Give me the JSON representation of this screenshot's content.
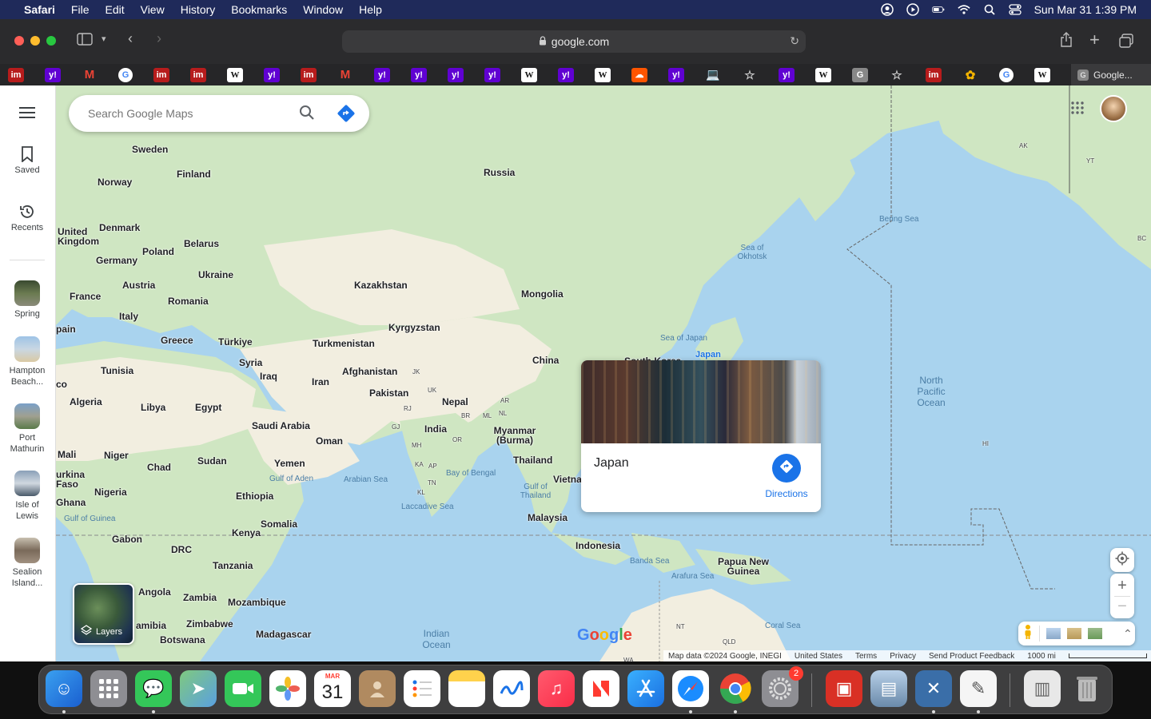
{
  "menubar": {
    "app_name": "Safari",
    "items": [
      "File",
      "Edit",
      "View",
      "History",
      "Bookmarks",
      "Window",
      "Help"
    ],
    "datetime": "Sun Mar 31  1:39 PM"
  },
  "browser": {
    "url": "google.com",
    "active_tab_label": "Google..."
  },
  "maps": {
    "search_placeholder": "Search Google Maps",
    "rail": {
      "saved": "Saved",
      "recents": "Recents",
      "recent_places": [
        "Spring",
        "Hampton Beach...",
        "Port Mathurin",
        "Isle of Lewis",
        "Sealion Island..."
      ]
    },
    "place_card": {
      "name": "Japan",
      "directions": "Directions"
    },
    "pin_label": "Japan",
    "layers_label": "Layers",
    "google_logo": "Google",
    "attribution": {
      "map_data": "Map data ©2024 Google, INEGI",
      "region": "United States",
      "terms": "Terms",
      "privacy": "Privacy",
      "feedback": "Send Product Feedback",
      "scale": "1000 mi"
    },
    "labels": {
      "russia": "Russia",
      "sweden": "Sweden",
      "finland": "Finland",
      "norway": "Norway",
      "denmark": "Denmark",
      "uk": "United Kingdom",
      "belarus": "Belarus",
      "poland": "Poland",
      "germany": "Germany",
      "ukraine": "Ukraine",
      "austria": "Austria",
      "france": "France",
      "romania": "Romania",
      "italy": "Italy",
      "spain": "pain",
      "greece": "Greece",
      "turkiye": "Türkiye",
      "kazakhstan": "Kazakhstan",
      "mongolia": "Mongolia",
      "kyrgyzstan": "Kyrgyzstan",
      "turkmenistan": "Turkmenistan",
      "syria": "Syria",
      "iraq": "Iraq",
      "iran": "Iran",
      "afghanistan": "Afghanistan",
      "pakistan": "Pakistan",
      "nepal": "Nepal",
      "china": "China",
      "tunisia": "Tunisia",
      "algeria": "Algeria",
      "libya": "Libya",
      "egypt": "Egypt",
      "saudi": "Saudi Arabia",
      "oman": "Oman",
      "yemen": "Yemen",
      "india": "India",
      "myanmar": "Myanmar (Burma)",
      "thailand": "Thailand",
      "vietnam": "Vietna",
      "mali": "Mali",
      "niger": "Niger",
      "chad": "Chad",
      "sudan": "Sudan",
      "burkina": "urkina Faso",
      "nigeria": "Nigeria",
      "ethiopia": "Ethiopia",
      "somalia": "Somalia",
      "ghana": "Ghana",
      "kenya": "Kenya",
      "gabon": "Gabon",
      "drc": "DRC",
      "tanzania": "Tanzania",
      "angola": "Angola",
      "zambia": "Zambia",
      "mozambique": "Mozambique",
      "namibia": "amibia",
      "zimbabwe": "Zimbabwe",
      "botswana": "Botswana",
      "madagascar": "Madagascar",
      "malaysia": "Malaysia",
      "indonesia": "Indonesia",
      "png": "Papua New Guinea",
      "south_korea": "South Korea",
      "morocco": "co"
    },
    "water_labels": {
      "bering": "Bering Sea",
      "okhotsk": "Sea of Okhotsk",
      "japan_sea": "Sea of Japan",
      "north_pacific": "North Pacific Ocean",
      "arabian": "Arabian Sea",
      "bengal": "Bay of Bengal",
      "thailand_gulf": "Gulf of Thailand",
      "aden": "Gulf of Aden",
      "laccadive": "Laccadive Sea",
      "guinea_gulf": "Gulf of Guinea",
      "indian": "Indian Ocean",
      "banda": "Banda Sea",
      "arafura": "Arafura Sea",
      "coral": "Coral Sea"
    },
    "small_labels": {
      "ak": "AK",
      "yt": "YT",
      "bc": "BC",
      "hi": "HI",
      "nt": "NT",
      "qld": "QLD",
      "wa": "WA",
      "mh": "MH",
      "gj": "GJ",
      "ka": "KA",
      "ap": "AP",
      "tn": "TN",
      "kl": "KL",
      "or": "OR",
      "rj": "RJ",
      "uk": "UK",
      "br": "BR",
      "ml": "ML",
      "nl": "NL",
      "ar": "AR",
      "jk": "JK"
    }
  },
  "dock": {
    "calendar_month": "MAR",
    "calendar_day": "31",
    "settings_badge": "2"
  },
  "colors": {
    "water": "#a9d3ee",
    "land": "#cfe6c2",
    "desert": "#f2eee0",
    "accent": "#1a73e8"
  }
}
